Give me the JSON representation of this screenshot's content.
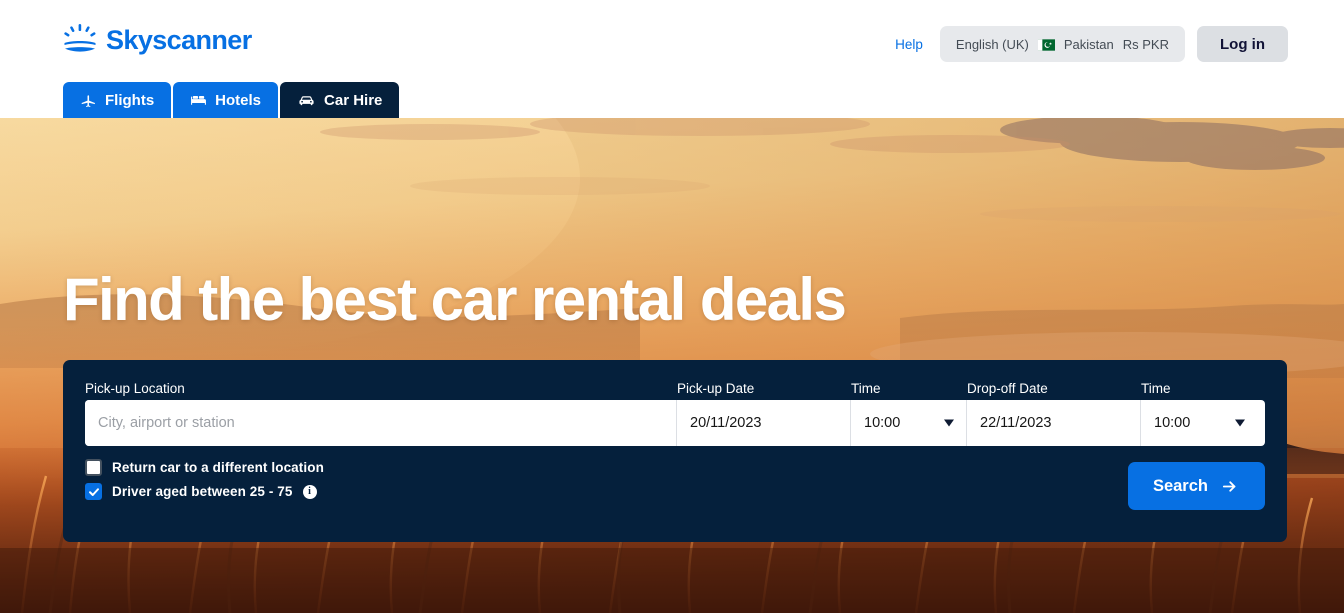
{
  "brand": {
    "name": "Skyscanner",
    "logo_color": "#0770e3"
  },
  "header": {
    "help_label": "Help",
    "locale": {
      "language": "English (UK)",
      "country": "Pakistan",
      "currency": "Rs PKR",
      "flag_icon": "pakistan-flag-icon"
    },
    "login_label": "Log in"
  },
  "nav": {
    "tabs": [
      {
        "label": "Flights",
        "icon": "plane-icon",
        "active": false
      },
      {
        "label": "Hotels",
        "icon": "bed-icon",
        "active": false
      },
      {
        "label": "Car Hire",
        "icon": "car-icon",
        "active": true
      }
    ]
  },
  "hero": {
    "title": "Find the best car rental deals",
    "background_description": "sunset-field-with-car-silhouette"
  },
  "search_form": {
    "labels": {
      "pickup_location": "Pick-up Location",
      "pickup_date": "Pick-up Date",
      "pickup_time": "Time",
      "dropoff_date": "Drop-off Date",
      "dropoff_time": "Time"
    },
    "values": {
      "pickup_location": "",
      "pickup_location_placeholder": "City, airport or station",
      "pickup_date": "20/11/2023",
      "pickup_time": "10:00",
      "dropoff_date": "22/11/2023",
      "dropoff_time": "10:00"
    },
    "options": {
      "return_different_location": {
        "label": "Return car to a different location",
        "checked": false
      },
      "driver_age": {
        "label": "Driver aged between 25 - 75",
        "checked": true,
        "info_glyph": "i"
      }
    },
    "search_button": "Search",
    "accent_color": "#0770e3",
    "panel_color": "#05203c"
  }
}
